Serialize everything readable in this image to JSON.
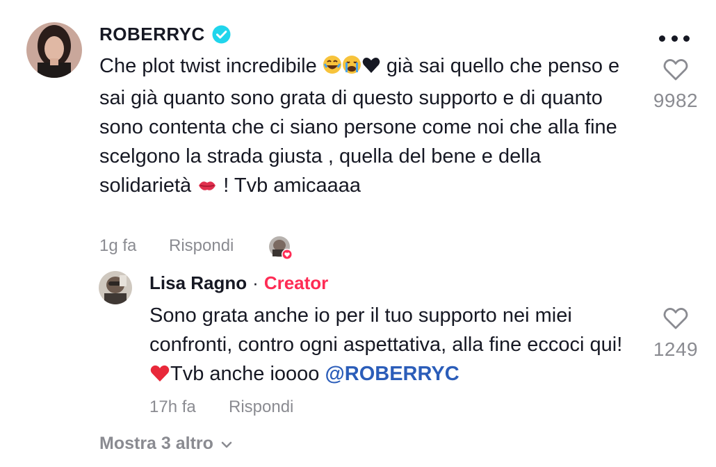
{
  "comment": {
    "username": "ROBERRYC",
    "text_part1": "Che plot twist incredibile ",
    "text_part2": " già sai quello che penso e sai già quanto sono grata di questo supporto e di quanto sono contenta che ci siano persone come noi che alla fine scelgono la strada giusta , quella del bene e della solidarietà ",
    "text_part3": " ! Tvb amicaaaa",
    "time": "1g fa",
    "reply_label": "Rispondi",
    "like_count": "9982"
  },
  "reply": {
    "username": "Lisa Ragno",
    "separator": "·",
    "badge": "Creator",
    "text_part1": "Sono grata anche io per il tuo supporto nei miei confronti, contro ogni aspettativa, alla fine eccoci qui!",
    "text_part2": "Tvb anche ioooo ",
    "mention": "@ROBERRYC",
    "time": "17h fa",
    "reply_label": "Rispondi",
    "like_count": "1249"
  },
  "show_more_label": "Mostra 3 altro",
  "colors": {
    "text": "#161823",
    "muted": "#8a8b91",
    "creator": "#fe2c55",
    "mention": "#2b5db9",
    "verified": "#20d5ec"
  },
  "icons": {
    "verified": "verified-badge-icon",
    "more": "more-dots-icon",
    "like": "heart-outline-icon",
    "show_more": "chevron-down-icon"
  }
}
